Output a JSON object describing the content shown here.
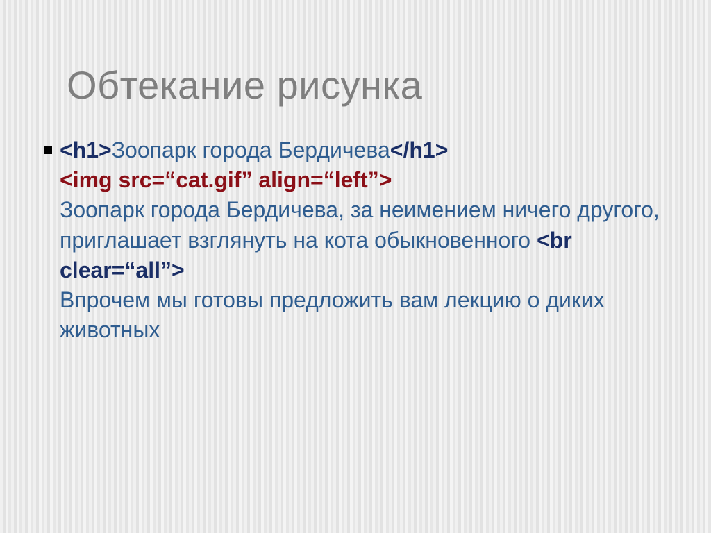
{
  "slide": {
    "title": "Обтекание рисунка",
    "h1_open": "<h1>",
    "h1_text": "Зоопарк города Бердичева",
    "h1_close": "</h1>",
    "img_tag": "<img src=“cat.gif” align=“left”>",
    "para1": "Зоопарк города Бердичева, за неимением ничего другого, приглашает взглянуть на кота обыкновенного ",
    "br_tag": "<br clear=“all”>",
    "para2": "Впрочем мы готовы предложить вам лекцию о диких животных"
  }
}
